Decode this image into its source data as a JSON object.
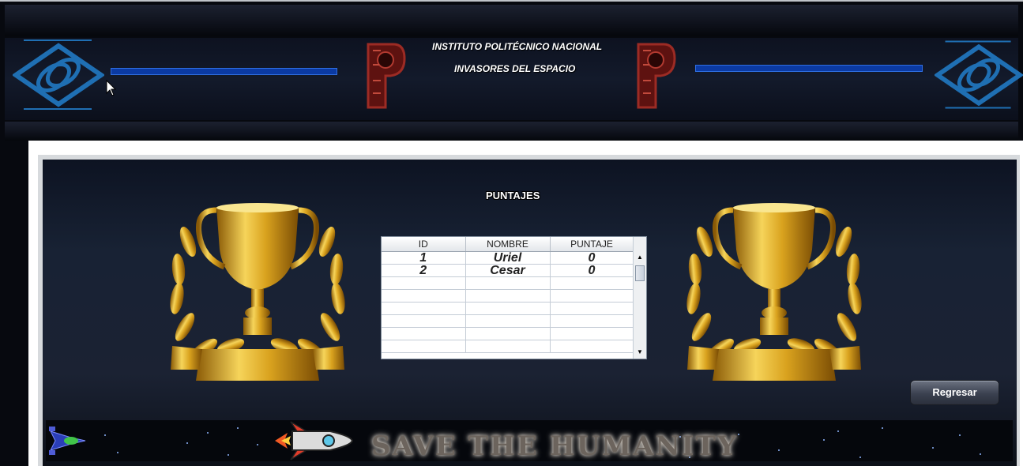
{
  "header": {
    "institute": "INSTITUTO POLITÉCNICO NACIONAL",
    "game_title": "INVASORES DEL ESPACIO"
  },
  "main": {
    "title": "PUNTAJES",
    "table": {
      "columns": [
        "ID",
        "NOMBRE",
        "PUNTAJE"
      ],
      "rows": [
        {
          "id": "1",
          "nombre": "Uriel",
          "puntaje": "0"
        },
        {
          "id": "2",
          "nombre": "Cesar",
          "puntaje": "0"
        }
      ],
      "empty_rows": 6
    },
    "back_button": "Regresar"
  },
  "banner": {
    "text": "SAVE THE HUMANITY"
  },
  "colors": {
    "background": "#07090f",
    "accent_blue": "#0b3aa3",
    "trophy_gold": "#d9a21e"
  }
}
